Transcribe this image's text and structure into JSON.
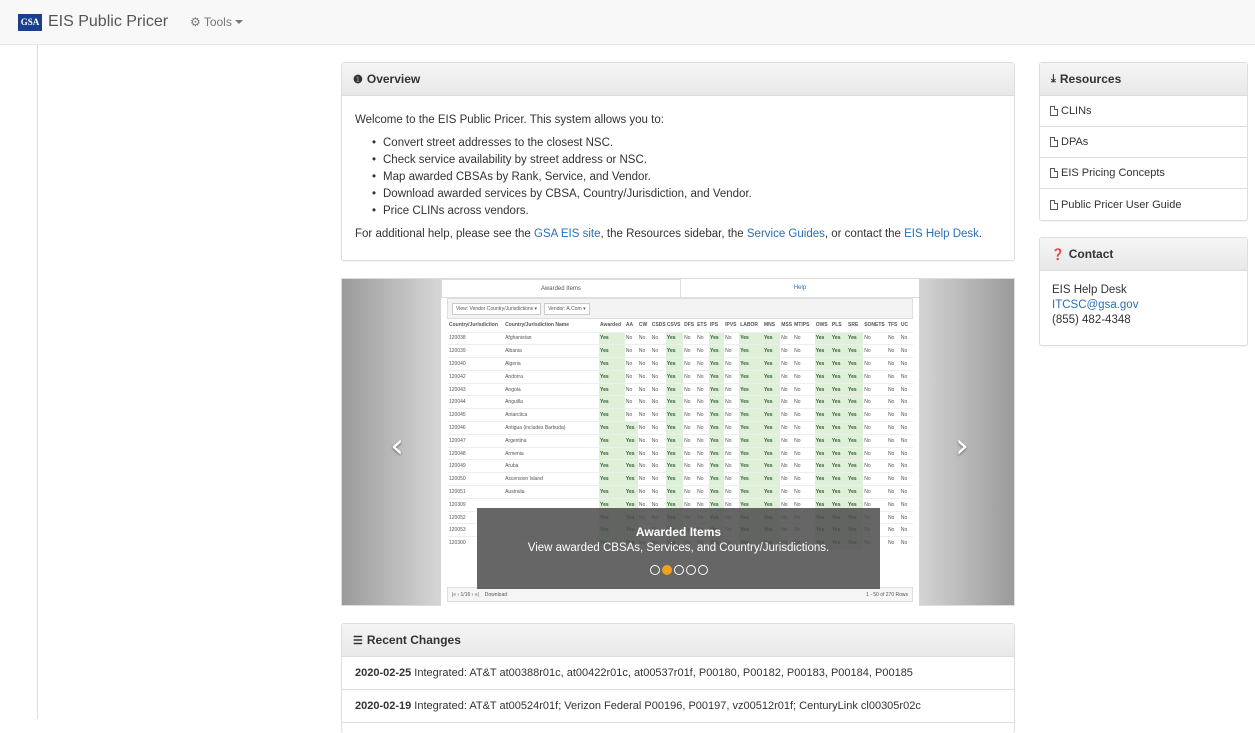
{
  "navbar": {
    "logo_text": "GSA",
    "brand": "EIS Public Pricer",
    "tools_label": "Tools"
  },
  "overview": {
    "title": "Overview",
    "intro": "Welcome to the EIS Public Pricer. This system allows you to:",
    "bullets": [
      "Convert street addresses to the closest NSC.",
      "Check service availability by street address or NSC.",
      "Map awarded CBSAs by Rank, Service, and Vendor.",
      "Download awarded services by CBSA, Country/Jurisdiction, and Vendor.",
      "Price CLINs across vendors."
    ],
    "help_prefix": "For additional help, please see the ",
    "link_eis_site": "GSA EIS site",
    "help_mid1": ", the Resources sidebar, the ",
    "link_service_guides": "Service Guides",
    "help_mid2": ", or contact the ",
    "link_help_desk": "EIS Help Desk",
    "help_suffix": "."
  },
  "carousel": {
    "tab_awarded": "Awarded Items",
    "tab_help": "Help",
    "btn_view": "View: Vendor Country/Jurisdictions ▾",
    "btn_vendor": "Vendor: A.Com ▾",
    "columns": [
      "Country/Jurisdiction",
      "Country/Jurisdiction Name",
      "Awarded",
      "AA",
      "CW",
      "CSDS",
      "CSVS",
      "DFS",
      "ETS",
      "IPS",
      "IPVS",
      "LABOR",
      "MNS",
      "MSS",
      "MTIPS",
      "OWS",
      "PLS",
      "SRE",
      "SONETS",
      "TFS",
      "UC"
    ],
    "rows": [
      [
        "120038",
        "Afghanistan",
        "Yes",
        "No",
        "No",
        "No",
        "Yes",
        "No",
        "No",
        "Yes",
        "No",
        "Yes",
        "Yes",
        "No",
        "No",
        "Yes",
        "Yes",
        "Yes",
        "No",
        "No",
        "No"
      ],
      [
        "120039",
        "Albania",
        "Yes",
        "No",
        "No",
        "No",
        "Yes",
        "No",
        "No",
        "Yes",
        "No",
        "Yes",
        "Yes",
        "No",
        "No",
        "Yes",
        "Yes",
        "Yes",
        "No",
        "No",
        "No"
      ],
      [
        "120040",
        "Algeria",
        "Yes",
        "No",
        "No",
        "No",
        "Yes",
        "No",
        "No",
        "Yes",
        "No",
        "Yes",
        "Yes",
        "No",
        "No",
        "Yes",
        "Yes",
        "Yes",
        "No",
        "No",
        "No"
      ],
      [
        "120042",
        "Andorra",
        "Yes",
        "No",
        "No",
        "No",
        "Yes",
        "No",
        "No",
        "Yes",
        "No",
        "Yes",
        "Yes",
        "No",
        "No",
        "Yes",
        "Yes",
        "Yes",
        "No",
        "No",
        "No"
      ],
      [
        "120043",
        "Angola",
        "Yes",
        "No",
        "No",
        "No",
        "Yes",
        "No",
        "No",
        "Yes",
        "No",
        "Yes",
        "Yes",
        "No",
        "No",
        "Yes",
        "Yes",
        "Yes",
        "No",
        "No",
        "No"
      ],
      [
        "120044",
        "Anguilla",
        "Yes",
        "No",
        "No",
        "No",
        "Yes",
        "No",
        "No",
        "Yes",
        "No",
        "Yes",
        "Yes",
        "No",
        "No",
        "Yes",
        "Yes",
        "Yes",
        "No",
        "No",
        "No"
      ],
      [
        "120045",
        "Antarctica",
        "Yes",
        "No",
        "No",
        "No",
        "Yes",
        "No",
        "No",
        "Yes",
        "No",
        "Yes",
        "Yes",
        "No",
        "No",
        "Yes",
        "Yes",
        "Yes",
        "No",
        "No",
        "No"
      ],
      [
        "120046",
        "Antigua (includes Barbuda)",
        "Yes",
        "Yes",
        "No",
        "No",
        "Yes",
        "No",
        "No",
        "Yes",
        "No",
        "Yes",
        "Yes",
        "No",
        "No",
        "Yes",
        "Yes",
        "Yes",
        "No",
        "No",
        "No"
      ],
      [
        "120047",
        "Argentina",
        "Yes",
        "Yes",
        "No",
        "No",
        "Yes",
        "No",
        "No",
        "Yes",
        "No",
        "Yes",
        "Yes",
        "No",
        "No",
        "Yes",
        "Yes",
        "Yes",
        "No",
        "No",
        "No"
      ],
      [
        "120048",
        "Armenia",
        "Yes",
        "Yes",
        "No",
        "No",
        "Yes",
        "No",
        "No",
        "Yes",
        "No",
        "Yes",
        "Yes",
        "No",
        "No",
        "Yes",
        "Yes",
        "Yes",
        "No",
        "No",
        "No"
      ],
      [
        "120049",
        "Aruba",
        "Yes",
        "Yes",
        "No",
        "No",
        "Yes",
        "No",
        "No",
        "Yes",
        "No",
        "Yes",
        "Yes",
        "No",
        "No",
        "Yes",
        "Yes",
        "Yes",
        "No",
        "No",
        "No"
      ],
      [
        "120050",
        "Ascension Island",
        "Yes",
        "Yes",
        "No",
        "No",
        "Yes",
        "No",
        "No",
        "Yes",
        "No",
        "Yes",
        "Yes",
        "No",
        "No",
        "Yes",
        "Yes",
        "Yes",
        "No",
        "No",
        "No"
      ],
      [
        "120051",
        "Australia",
        "Yes",
        "Yes",
        "No",
        "No",
        "Yes",
        "No",
        "No",
        "Yes",
        "No",
        "Yes",
        "Yes",
        "No",
        "No",
        "Yes",
        "Yes",
        "Yes",
        "No",
        "No",
        "No"
      ],
      [
        "120309",
        "",
        "Yes",
        "Yes",
        "No",
        "No",
        "Yes",
        "No",
        "No",
        "Yes",
        "No",
        "Yes",
        "Yes",
        "No",
        "No",
        "Yes",
        "Yes",
        "Yes",
        "No",
        "No",
        "No"
      ],
      [
        "120052",
        "",
        "Yes",
        "Yes",
        "No",
        "No",
        "Yes",
        "No",
        "No",
        "Yes",
        "No",
        "Yes",
        "Yes",
        "No",
        "No",
        "Yes",
        "Yes",
        "Yes",
        "No",
        "No",
        "No"
      ],
      [
        "120053",
        "",
        "Yes",
        "Yes",
        "No",
        "No",
        "Yes",
        "No",
        "No",
        "Yes",
        "No",
        "Yes",
        "Yes",
        "No",
        "No",
        "Yes",
        "Yes",
        "Yes",
        "No",
        "No",
        "No"
      ],
      [
        "120300",
        "",
        "Yes",
        "Yes",
        "No",
        "No",
        "Yes",
        "No",
        "No",
        "Yes",
        "No",
        "Yes",
        "Yes",
        "No",
        "No",
        "Yes",
        "Yes",
        "Yes",
        "No",
        "No",
        "No"
      ]
    ],
    "footer_pager": "|«  ‹  1/16  ›  »|",
    "footer_download": "Download",
    "footer_rows": "1 - 50 of 270 Rows",
    "caption_title": "Awarded Items",
    "caption_text": "View awarded CBSAs, Services, and Country/Jurisdictions.",
    "slide_count": 5,
    "active_slide": 2
  },
  "recent": {
    "title": "Recent Changes",
    "items": [
      {
        "date": "2020-02-25",
        "text": "Integrated: AT&T at00388r01c, at00422r01c, at00537r01f, P00180, P00182, P00183, P00184, P00185"
      },
      {
        "date": "2020-02-19",
        "text": "Integrated: AT&T at00524r01f; Verizon Federal P00196, P00197, vz00512r01f; CenturyLink cl00305r02c"
      }
    ]
  },
  "resources": {
    "title": "Resources",
    "items": [
      "CLINs",
      "DPAs",
      "EIS Pricing Concepts",
      "Public Pricer User Guide"
    ]
  },
  "contact": {
    "title": "Contact",
    "name": "EIS Help Desk",
    "email": "ITCSC@gsa.gov",
    "phone": "(855) 482-4348"
  },
  "colors": {
    "link": "#2a6fb8",
    "logo_blue": "#1a3f8e",
    "yes_cell": "#dff0d8",
    "active_indicator": "#f0a020"
  }
}
